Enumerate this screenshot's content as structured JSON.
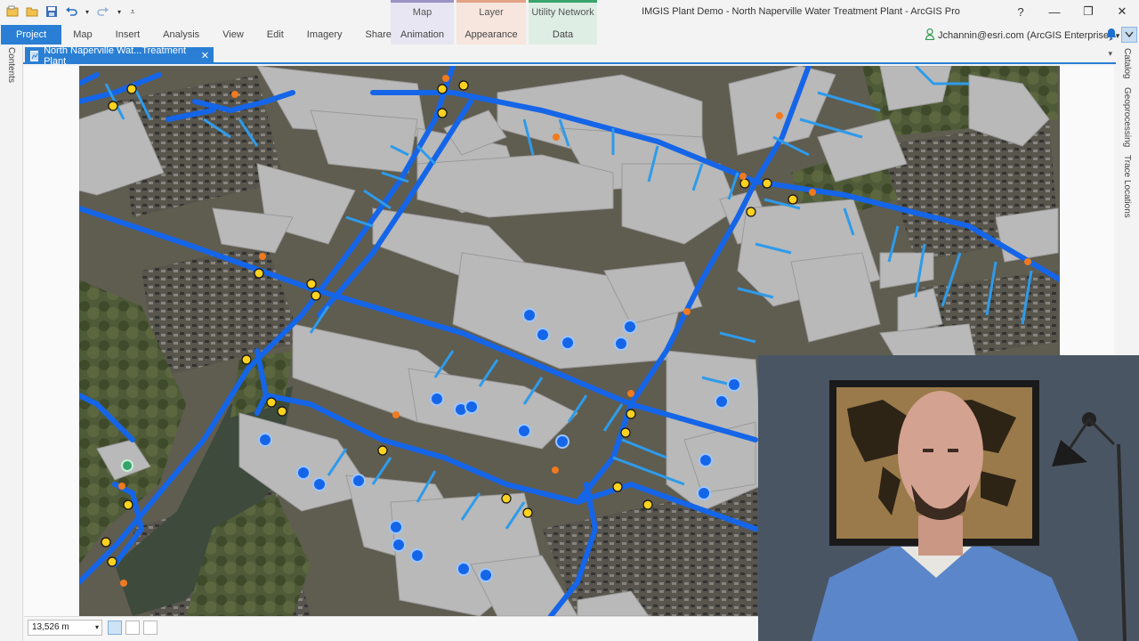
{
  "window": {
    "title": "IMGIS Plant Demo - North Naperville Water Treatment Plant - ArcGIS Pro",
    "help": "?",
    "minimize": "—",
    "restore": "❐",
    "close": "✕"
  },
  "context_tabs": [
    {
      "group": "Map",
      "sub": "Animation",
      "color": "#9a93c4",
      "bg": "#e8e6f2"
    },
    {
      "group": "Layer",
      "sub": "Appearance",
      "color": "#e3a385",
      "bg": "#f7e6de"
    },
    {
      "group": "Utility Network",
      "sub": "Data",
      "color": "#3aa46c",
      "bg": "#dfeee4"
    }
  ],
  "ribbon": {
    "tabs": [
      "Project",
      "Map",
      "Insert",
      "Analysis",
      "View",
      "Edit",
      "Imagery",
      "Share"
    ]
  },
  "user": {
    "name": "Jchannin@esri.com (ArcGIS Enterprise)",
    "dropdown": "▾"
  },
  "side_panes": {
    "left": [
      "Contents"
    ],
    "right": [
      "Catalog",
      "Geoprocessing",
      "Trace Locations"
    ]
  },
  "document_tab": {
    "label": "North Naperville Wat...Treatment Plant",
    "close": "✕"
  },
  "status": {
    "scale": "13,526 m",
    "dropdown": "▾"
  },
  "colors": {
    "accent": "#2a7fd4",
    "pipe_main": "#1565e8",
    "pipe_service": "#2e9bea",
    "valve": "#ffd21f",
    "hydrant": "#f07a1e",
    "building": "#b8b8b8"
  }
}
